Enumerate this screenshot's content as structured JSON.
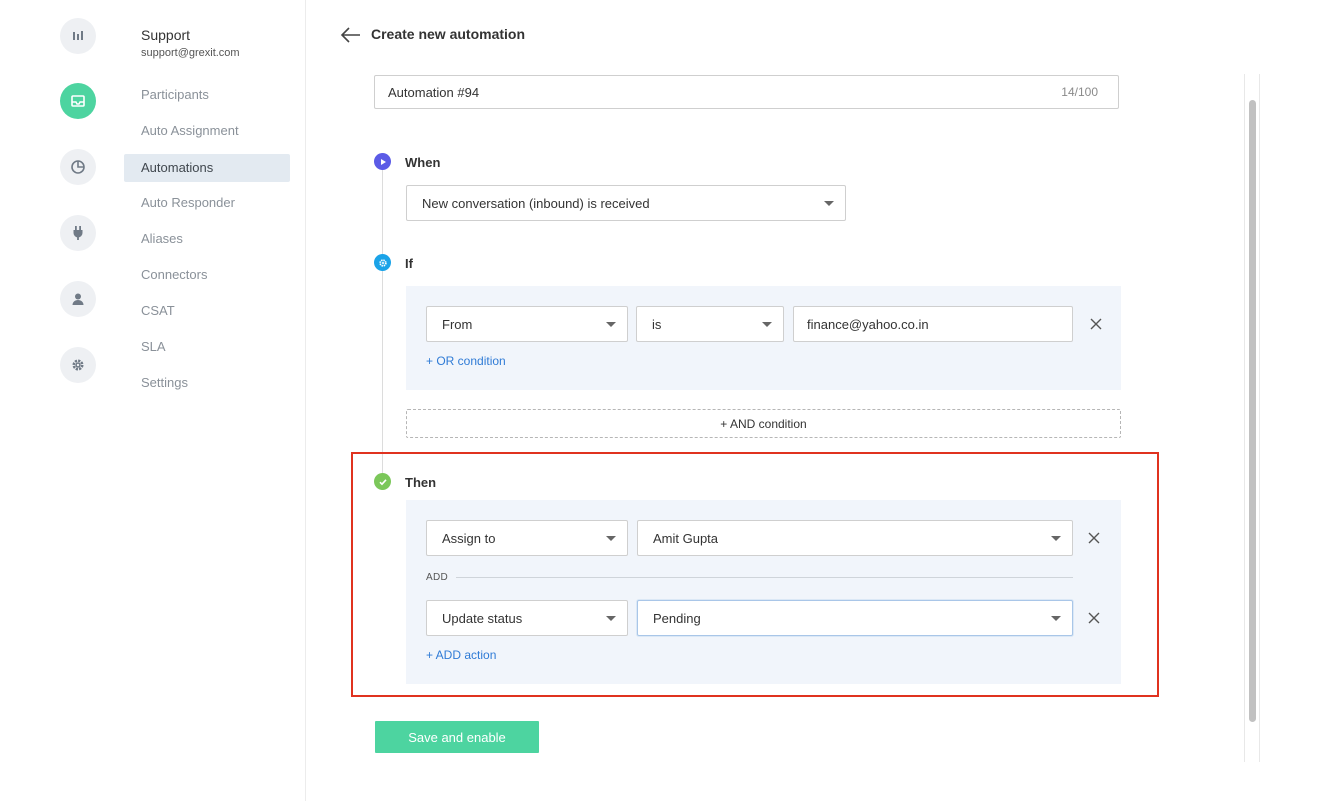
{
  "account": {
    "name": "Support",
    "email": "support@grexit.com"
  },
  "nav": [
    {
      "label": "Participants",
      "active": false
    },
    {
      "label": "Auto Assignment",
      "active": false
    },
    {
      "label": "Automations",
      "active": true
    },
    {
      "label": "Auto Responder",
      "active": false
    },
    {
      "label": "Aliases",
      "active": false
    },
    {
      "label": "Connectors",
      "active": false
    },
    {
      "label": "CSAT",
      "active": false
    },
    {
      "label": "SLA",
      "active": false
    },
    {
      "label": "Settings",
      "active": false
    }
  ],
  "rail_icons": [
    "bar-chart-icon",
    "inbox-icon",
    "pie-chart-icon",
    "plug-icon",
    "user-icon",
    "gear-icon"
  ],
  "header": {
    "title": "Create new automation"
  },
  "automation_name": {
    "value": "Automation #94",
    "count": "14/100"
  },
  "when": {
    "label": "When",
    "trigger": "New conversation (inbound) is received"
  },
  "if": {
    "label": "If",
    "condition": {
      "field": "From",
      "operator": "is",
      "value": "finance@yahoo.co.in"
    },
    "or_condition_label": "+ OR condition",
    "and_condition_label": "+ AND condition"
  },
  "then": {
    "label": "Then",
    "actions": [
      {
        "action": "Assign to",
        "value": "Amit Gupta"
      },
      {
        "action": "Update status",
        "value": "Pending"
      }
    ],
    "divider_label": "ADD",
    "add_action_label": "+ ADD action"
  },
  "save_label": "Save and enable",
  "colors": {
    "accent": "#4dd4a0",
    "when_dot": "#5b5be6",
    "if_dot": "#1aa3e8",
    "then_dot": "#7bc75a",
    "highlight": "#e0321f",
    "link": "#2f7bd6"
  }
}
